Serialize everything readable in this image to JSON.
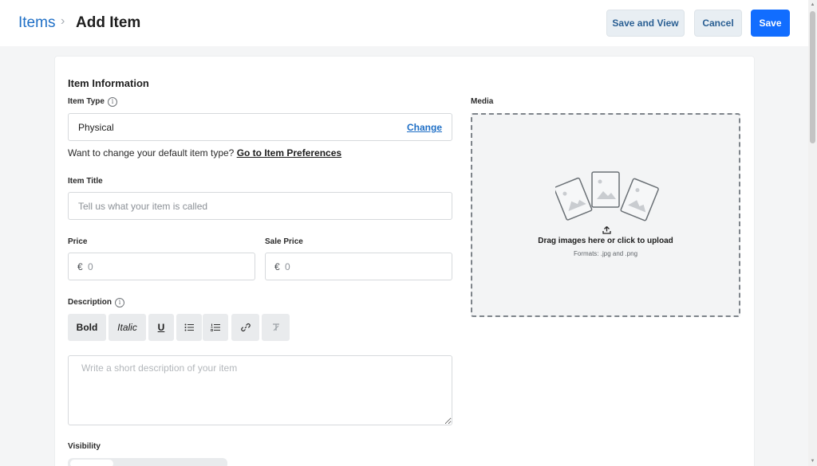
{
  "header": {
    "breadcrumb_root": "Items",
    "breadcrumb_separator": "›",
    "breadcrumb_current": "Add Item",
    "save_and_view_label": "Save and View",
    "cancel_label": "Cancel",
    "save_label": "Save"
  },
  "form": {
    "section_title": "Item Information",
    "item_type": {
      "label": "Item Type",
      "value": "Physical",
      "change_label": "Change",
      "hint_text": "Want to change your default item type?",
      "hint_link": "Go to Item Preferences"
    },
    "item_title": {
      "label": "Item Title",
      "placeholder": "Tell us what your item is called"
    },
    "price": {
      "label": "Price",
      "currency": "€",
      "placeholder": "0"
    },
    "sale_price": {
      "label": "Sale Price",
      "currency": "€",
      "placeholder": "0"
    },
    "description": {
      "label": "Description",
      "placeholder": "Write a short description of your item",
      "toolbar": {
        "bold": "Bold",
        "italic": "Italic",
        "underline": "U"
      }
    },
    "visibility": {
      "label": "Visibility"
    }
  },
  "media": {
    "label": "Media",
    "upload_text": "Drag images here or click to upload",
    "formats_text": "Formats: .jpg and .png"
  },
  "icons": {
    "info": "info-icon",
    "upload": "upload-icon",
    "bullet_list": "bullet-list-icon",
    "numbered_list": "numbered-list-icon",
    "link": "link-icon",
    "clear_format": "clear-format-icon",
    "images": "image-stack-icon"
  },
  "colors": {
    "accent": "#116dff",
    "link": "#1f6fc6",
    "secondary_button": "#e8eef3"
  }
}
